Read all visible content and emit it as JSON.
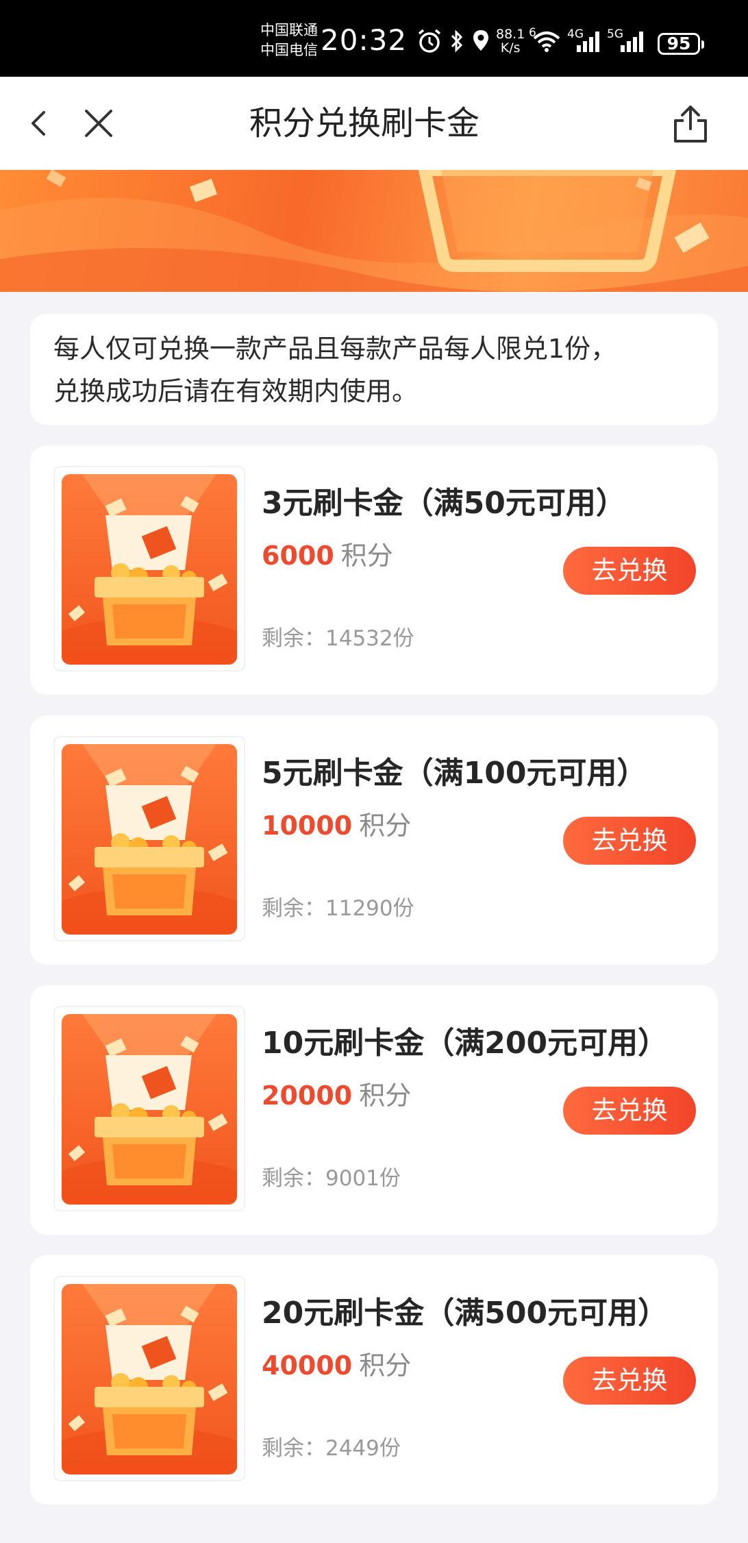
{
  "status_bar": {
    "carrier_1": "中国联通",
    "carrier_2": "中国电信",
    "time": "20:32",
    "net_speed_value": "88.1",
    "net_speed_unit": "K/s",
    "wifi_badge": "6",
    "signal_1_label": "4G",
    "signal_2_label": "5G",
    "battery": "95",
    "icons": [
      "alarm-icon",
      "bluetooth-icon",
      "location-icon",
      "wifi-icon",
      "signal-icon",
      "battery-icon"
    ]
  },
  "nav": {
    "title": "积分兑换刷卡金",
    "icons": [
      "back-icon",
      "close-icon",
      "share-icon"
    ]
  },
  "notice": {
    "line_1": "每人仅可兑换一款产品且每款产品每人限兑1份，",
    "line_2": "兑换成功后请在有效期内使用。"
  },
  "products": [
    {
      "title": "3元刷卡金（满50元可用）",
      "points": "6000",
      "points_unit": "积分",
      "button": "去兑换",
      "stock": "剩余：14532份"
    },
    {
      "title": "5元刷卡金（满100元可用）",
      "points": "10000",
      "points_unit": "积分",
      "button": "去兑换",
      "stock": "剩余：11290份"
    },
    {
      "title": "10元刷卡金（满200元可用）",
      "points": "20000",
      "points_unit": "积分",
      "button": "去兑换",
      "stock": "剩余：9001份"
    },
    {
      "title": "20元刷卡金（满500元可用）",
      "points": "40000",
      "points_unit": "积分",
      "button": "去兑换",
      "stock": "剩余：2449份"
    }
  ],
  "colors": {
    "accent": "#f2472c",
    "points": "#ee4a2e",
    "banner": "#f8692a"
  }
}
